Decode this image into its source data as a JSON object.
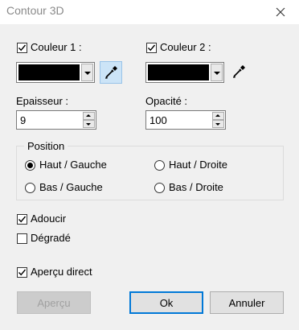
{
  "window": {
    "title": "Contour 3D"
  },
  "color1": {
    "label": "Couleur 1 :",
    "checked": true,
    "color": "#000000"
  },
  "color2": {
    "label": "Couleur 2 :",
    "checked": true,
    "color": "#000000"
  },
  "thickness": {
    "label": "Epaisseur :",
    "value": "9"
  },
  "opacity": {
    "label": "Opacité :",
    "value": "100"
  },
  "position": {
    "title": "Position",
    "options": [
      {
        "label": "Haut / Gauche",
        "checked": true
      },
      {
        "label": "Haut / Droite",
        "checked": false
      },
      {
        "label": "Bas / Gauche",
        "checked": false
      },
      {
        "label": "Bas / Droite",
        "checked": false
      }
    ]
  },
  "smooth": {
    "label": "Adoucir",
    "checked": true
  },
  "gradient": {
    "label": "Dégradé",
    "checked": false
  },
  "live_preview": {
    "label": "Aperçu direct",
    "checked": true
  },
  "buttons": {
    "preview": "Aperçu",
    "ok": "Ok",
    "cancel": "Annuler"
  },
  "icons": {
    "close": "close-icon",
    "picker": "eyedropper-icon",
    "check": "checkmark-icon"
  }
}
